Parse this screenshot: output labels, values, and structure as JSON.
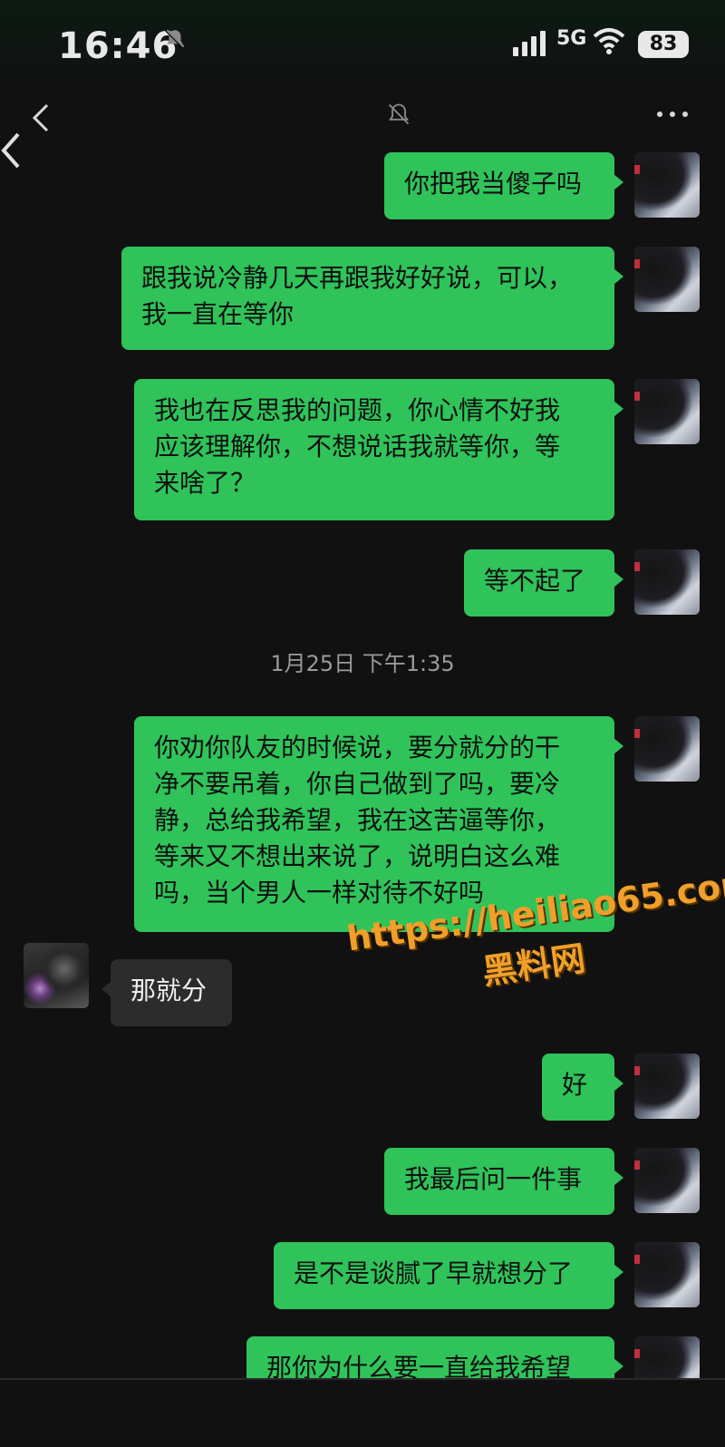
{
  "status_bar": {
    "time": "16:46",
    "network": "5G",
    "battery": "83"
  },
  "header": {
    "title_icon": "😈",
    "icons": [
      "back-icon",
      "mute-icon",
      "more-icon"
    ]
  },
  "messages": [
    {
      "side": "right",
      "text": "你把我当傻子吗"
    },
    {
      "side": "right",
      "text": "跟我说冷静几天再跟我好好说，可以，\n我一直在等你"
    },
    {
      "side": "right",
      "text": "我也在反思我的问题，你心情不好我\n应该理解你，不想说话我就等你，等\n来啥了？"
    },
    {
      "side": "right",
      "text": "等不起了"
    },
    {
      "side": "right",
      "text": "你劝你队友的时候说，要分就分的干\n净不要吊着，你自己做到了吗，要冷\n静，总给我希望，我在这苦逼等你，\n等来又不想出来说了，说明白这么难\n吗，当个男人一样对待不好吗"
    },
    {
      "side": "left",
      "text": "那就分"
    },
    {
      "side": "right",
      "text": "好"
    },
    {
      "side": "right",
      "text": "我最后问一件事"
    },
    {
      "side": "right",
      "text": "是不是谈腻了早就想分了"
    },
    {
      "side": "right",
      "text": "那你为什么要一直给我希望\n那你为什么什给给直"
    }
  ],
  "timestamp": "1月25日 下午1:35",
  "watermark": {
    "url": "https://heiliao65.com",
    "brand": "黑料网"
  },
  "colors": {
    "sent_bubble": "#2fc35a",
    "received_bubble": "#2c2c2c",
    "background": "#111111",
    "watermark": "#f0a02a"
  }
}
